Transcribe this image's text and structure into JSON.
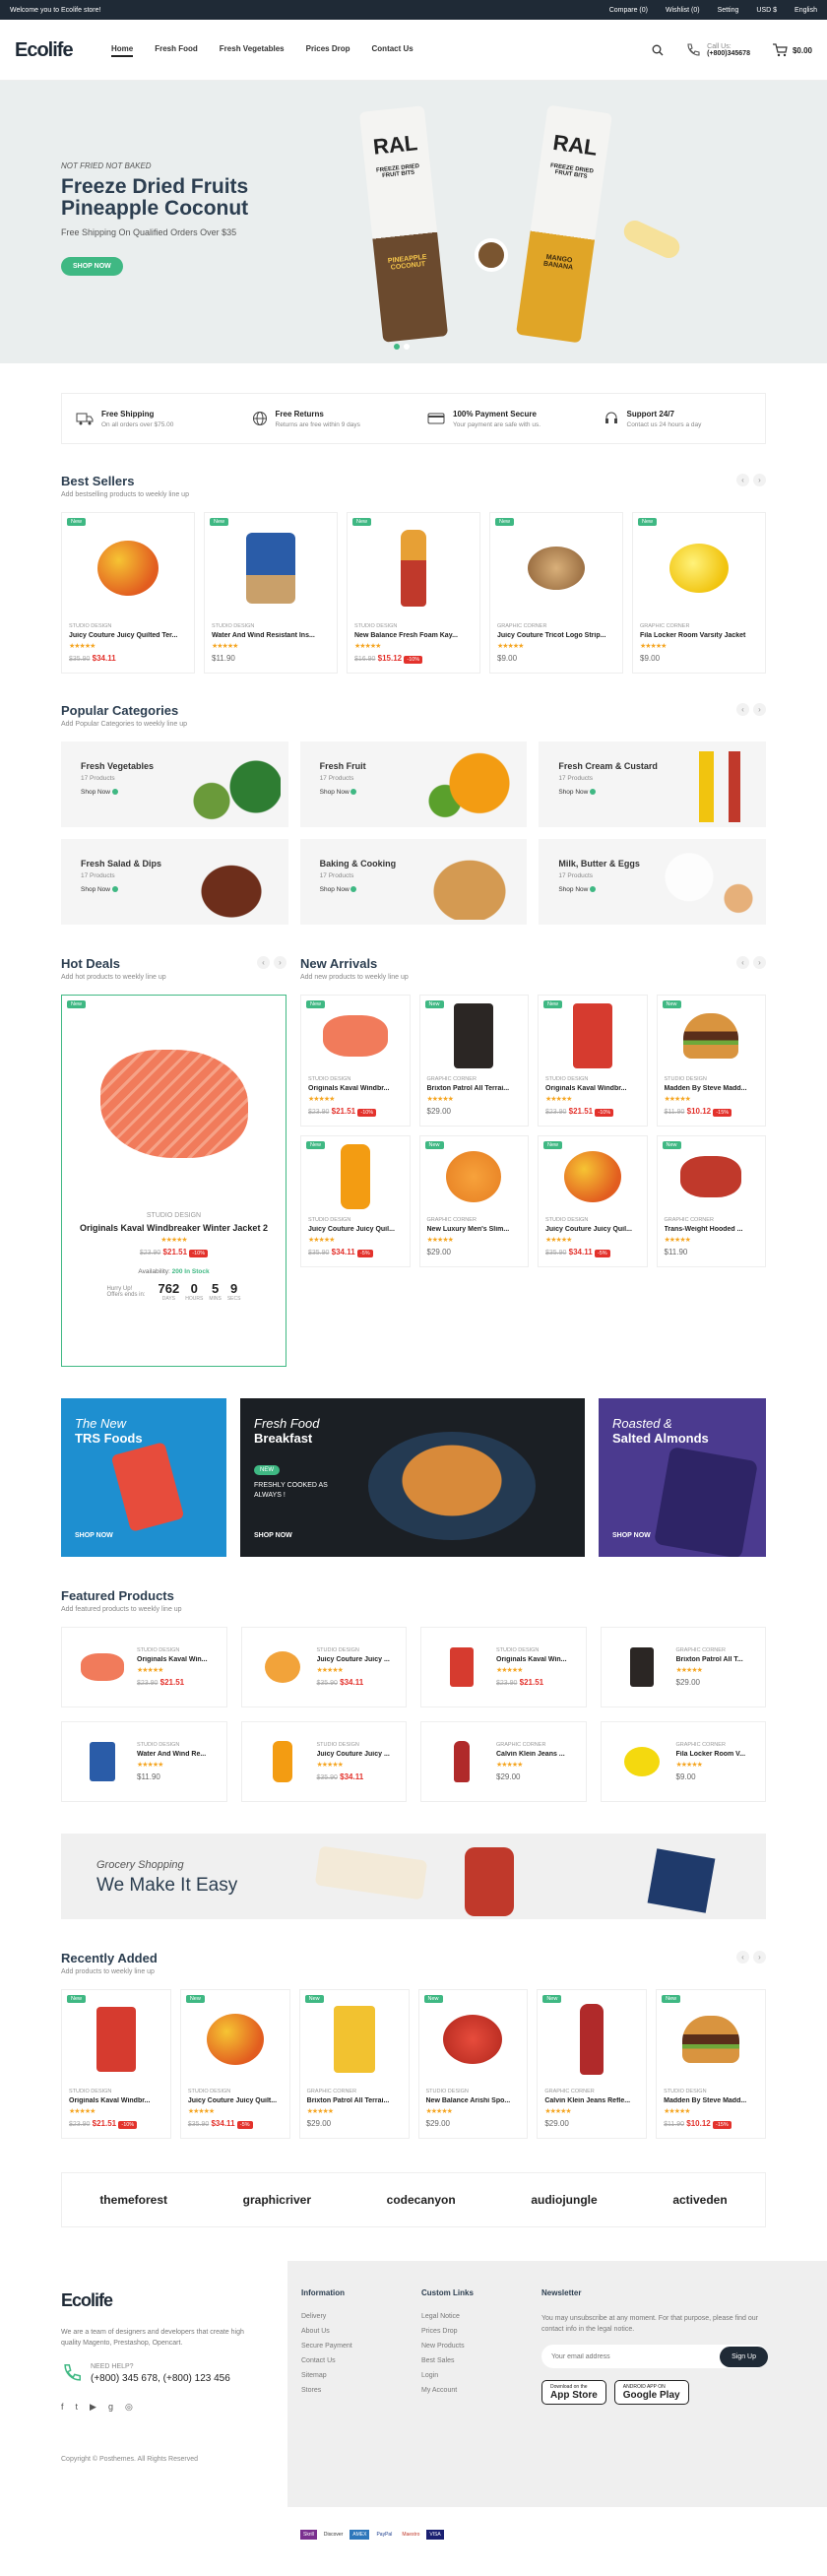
{
  "topbar": {
    "welcome": "Welcome you to Ecolife store!",
    "compare": "Compare (0)",
    "wishlist": "Wishlist (0)",
    "setting": "Setting",
    "currency": "USD $",
    "language": "English"
  },
  "header": {
    "logo": "Ecolife",
    "nav": [
      "Home",
      "Fresh Food",
      "Fresh Vegetables",
      "Prices Drop",
      "Contact Us"
    ],
    "call_label": "Call Us:",
    "phone": "(+800)345678",
    "cart": "$0.00",
    "cart_count": "0"
  },
  "hero": {
    "eyebrow": "NOT FRIED NOT BAKED",
    "title1": "Freeze Dried Fruits",
    "title2": "Pineapple Coconut",
    "sub": "Free Shipping On Qualified Orders Over $35",
    "button": "SHOP NOW",
    "pack1": "RAL",
    "pack2": "RAL",
    "pack1_label": "FREEZE DRIED FRUIT BITS",
    "pack2_label": "FREEZE DRIED FRUIT BITS",
    "pack1_flavor": "PINEAPPLE COCONUT",
    "pack2_flavor": "MANGO BANANA"
  },
  "features": [
    {
      "title": "Free Shipping",
      "sub": "On all orders over $75.00"
    },
    {
      "title": "Free Returns",
      "sub": "Returns are free within 9 days"
    },
    {
      "title": "100% Payment Secure",
      "sub": "Your payment are safe with us."
    },
    {
      "title": "Support 24/7",
      "sub": "Contact us 24 hours a day"
    }
  ],
  "bestsellers": {
    "title": "Best Sellers",
    "sub": "Add bestselling products to weekly line up",
    "items": [
      {
        "badge": "New",
        "brand": "STUDIO DESIGN",
        "name": "Juicy Couture Juicy Quilted Ter...",
        "old": "$35.90",
        "price": "$34.11",
        "off": ""
      },
      {
        "badge": "New",
        "brand": "STUDIO DESIGN",
        "name": "Water And Wind Resistant Ins...",
        "old": "",
        "price": "$11.90",
        "off": ""
      },
      {
        "badge": "New",
        "brand": "STUDIO DESIGN",
        "name": "New Balance Fresh Foam Kay...",
        "old": "$16.90",
        "price": "$15.12",
        "off": "-10%"
      },
      {
        "badge": "New",
        "brand": "GRAPHIC CORNER",
        "name": "Juicy Couture Tricot Logo Strip...",
        "old": "",
        "price": "$9.00",
        "off": ""
      },
      {
        "badge": "New",
        "brand": "GRAPHIC CORNER",
        "name": "Fila Locker Room Varsity Jacket",
        "old": "",
        "price": "$9.00",
        "off": ""
      }
    ]
  },
  "categories": {
    "title": "Popular Categories",
    "sub": "Add Popular Categories to weekly line up",
    "shop": "Shop Now",
    "items": [
      {
        "name": "Fresh Vegetables",
        "count": "17 Products"
      },
      {
        "name": "Fresh Fruit",
        "count": "17 Products"
      },
      {
        "name": "Fresh Cream & Custard",
        "count": "17 Products"
      },
      {
        "name": "Fresh Salad & Dips",
        "count": "17 Products"
      },
      {
        "name": "Baking & Cooking",
        "count": "17 Products"
      },
      {
        "name": "Milk, Butter & Eggs",
        "count": "17 Products"
      }
    ]
  },
  "hotdeals": {
    "title": "Hot Deals",
    "sub": "Add hot products to weekly line up",
    "badge": "New",
    "brand": "STUDIO DESIGN",
    "name": "Originals Kaval Windbreaker Winter Jacket 2",
    "old": "$23.90",
    "price": "$21.51",
    "off": "-10%",
    "availability": "Availability:",
    "stock": "200 In Stock",
    "hurry": "Hurry Up! Offers ends in:",
    "countdown": [
      {
        "v": "762",
        "l": "DAYS"
      },
      {
        "v": "0",
        "l": "HOURS"
      },
      {
        "v": "5",
        "l": "MINS"
      },
      {
        "v": "9",
        "l": "SECS"
      }
    ]
  },
  "newarrivals": {
    "title": "New Arrivals",
    "sub": "Add new products to weekly line up",
    "items": [
      {
        "brand": "STUDIO DESIGN",
        "name": "Originals Kaval Windbr...",
        "old": "$23.90",
        "price": "$21.51",
        "off": "-10%"
      },
      {
        "brand": "GRAPHIC CORNER",
        "name": "Brixton Patrol All Terrai...",
        "old": "",
        "price": "$29.00",
        "off": ""
      },
      {
        "brand": "STUDIO DESIGN",
        "name": "Originals Kaval Windbr...",
        "old": "$23.90",
        "price": "$21.51",
        "off": "-10%"
      },
      {
        "brand": "STUDIO DESIGN",
        "name": "Madden By Steve Madd...",
        "old": "$11.90",
        "price": "$10.12",
        "off": "-15%"
      },
      {
        "brand": "STUDIO DESIGN",
        "name": "Juicy Couture Juicy Quil...",
        "old": "$35.90",
        "price": "$34.11",
        "off": "-5%"
      },
      {
        "brand": "GRAPHIC CORNER",
        "name": "New Luxury Men's Slim...",
        "old": "",
        "price": "$29.00",
        "off": ""
      },
      {
        "brand": "STUDIO DESIGN",
        "name": "Juicy Couture Juicy Quil...",
        "old": "$35.90",
        "price": "$34.11",
        "off": "-5%"
      },
      {
        "brand": "GRAPHIC CORNER",
        "name": "Trans-Weight Hooded ...",
        "old": "",
        "price": "$11.90",
        "off": ""
      }
    ]
  },
  "banners": [
    {
      "t1": "The New",
      "t2": "TRS Foods",
      "shop": "SHOP NOW"
    },
    {
      "t1": "Fresh Food",
      "t2": "Breakfast",
      "tag": "NEW",
      "desc": "FRESHLY COOKED AS ALWAYS !",
      "shop": "SHOP NOW"
    },
    {
      "t1": "Roasted &",
      "t2": "Salted Almonds",
      "shop": "SHOP NOW"
    }
  ],
  "featured": {
    "title": "Featured Products",
    "sub": "Add featured products to weekly line up",
    "items": [
      {
        "brand": "STUDIO DESIGN",
        "name": "Originals Kaval Win...",
        "old": "$23.90",
        "price": "$21.51"
      },
      {
        "brand": "STUDIO DESIGN",
        "name": "Juicy Couture Juicy ...",
        "old": "$35.90",
        "price": "$34.11"
      },
      {
        "brand": "STUDIO DESIGN",
        "name": "Originals Kaval Win...",
        "old": "$23.90",
        "price": "$21.51"
      },
      {
        "brand": "GRAPHIC CORNER",
        "name": "Brixton Patrol All T...",
        "old": "",
        "price": "$29.00"
      },
      {
        "brand": "STUDIO DESIGN",
        "name": "Water And Wind Re...",
        "old": "",
        "price": "$11.90"
      },
      {
        "brand": "STUDIO DESIGN",
        "name": "Juicy Couture Juicy ...",
        "old": "$35.90",
        "price": "$34.11"
      },
      {
        "brand": "GRAPHIC CORNER",
        "name": "Calvin Klein Jeans ...",
        "old": "",
        "price": "$29.00"
      },
      {
        "brand": "GRAPHIC CORNER",
        "name": "Fila Locker Room V...",
        "old": "",
        "price": "$9.00"
      }
    ]
  },
  "grocery": {
    "t1": "Grocery Shopping",
    "t2": "We Make It Easy"
  },
  "recent": {
    "title": "Recently Added",
    "sub": "Add products to weekly line up",
    "items": [
      {
        "brand": "STUDIO DESIGN",
        "name": "Originals Kaval Windbr...",
        "old": "$23.90",
        "price": "$21.51",
        "off": "-10%"
      },
      {
        "brand": "STUDIO DESIGN",
        "name": "Juicy Couture Juicy Quilt...",
        "old": "$35.90",
        "price": "$34.11",
        "off": "-5%"
      },
      {
        "brand": "GRAPHIC CORNER",
        "name": "Brixton Patrol All Terrai...",
        "old": "",
        "price": "$29.00",
        "off": ""
      },
      {
        "brand": "STUDIO DESIGN",
        "name": "New Balance Arishi Spo...",
        "old": "",
        "price": "$29.00",
        "off": ""
      },
      {
        "brand": "GRAPHIC CORNER",
        "name": "Calvin Klein Jeans Refle...",
        "old": "",
        "price": "$29.00",
        "off": ""
      },
      {
        "brand": "STUDIO DESIGN",
        "name": "Madden By Steve Madd...",
        "old": "$11.90",
        "price": "$10.12",
        "off": "-15%"
      }
    ]
  },
  "brands": [
    "themeforest",
    "graphicriver",
    "codecanyon",
    "audiojungle",
    "activeden"
  ],
  "footer": {
    "logo": "Ecolife",
    "about": "We are a team of designers and developers that create high quality Magento, Prestashop, Opencart.",
    "help": "NEED HELP?",
    "phones": "(+800) 345 678, (+800) 123 456",
    "copyright": "Copyright © Posthemes. All Rights Reserved",
    "info_title": "Information",
    "info": [
      "Delivery",
      "About Us",
      "Secure Payment",
      "Contact Us",
      "Sitemap",
      "Stores"
    ],
    "links_title": "Custom Links",
    "links": [
      "Legal Notice",
      "Prices Drop",
      "New Products",
      "Best Sales",
      "Login",
      "My Account"
    ],
    "news_title": "Newsletter",
    "news_text": "You may unsubscribe at any moment. For that purpose, please find our contact info in the legal notice.",
    "email_ph": "Your email address",
    "signup": "Sign Up",
    "appstore_small": "Download on the",
    "appstore": "App Store",
    "gplay_small": "ANDROID APP ON",
    "gplay": "Google Play",
    "payments": [
      "Skrill",
      "Discover",
      "AMEX",
      "PayPal",
      "Maestro",
      "VISA"
    ]
  }
}
